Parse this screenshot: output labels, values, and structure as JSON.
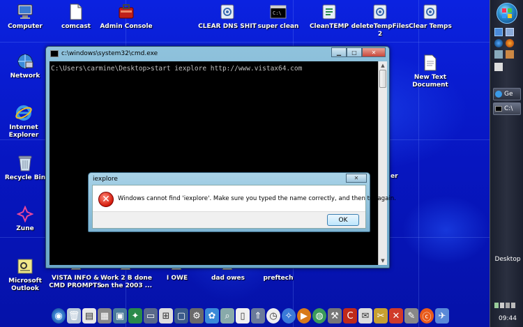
{
  "desktop": {
    "icons": [
      {
        "label": "Computer",
        "icon": "computer-icon"
      },
      {
        "label": "comcast",
        "icon": "document-icon"
      },
      {
        "label": "Admin Console",
        "icon": "toolbox-icon"
      },
      {
        "label": "CLEAR DNS SHIT",
        "icon": "script-icon"
      },
      {
        "label": "super clean",
        "icon": "cmd-icon"
      },
      {
        "label": "CleanTEMP",
        "icon": "script-icon"
      },
      {
        "label": "deleteTempFiles 2",
        "icon": "script-icon"
      },
      {
        "label": "Clear Temps",
        "icon": "script-icon"
      },
      {
        "label": "Network",
        "icon": "network-icon"
      },
      {
        "label": "New Text Document",
        "icon": "text-file-icon"
      },
      {
        "label": "Internet Explorer",
        "icon": "ie-icon"
      },
      {
        "label": "Recycle Bin",
        "icon": "recycle-bin-icon"
      },
      {
        "label": "Zune",
        "icon": "zune-icon"
      },
      {
        "label": "Microsoft Outlook",
        "icon": "outlook-icon"
      },
      {
        "label": "VISTA INFO & CMD PROMPTS",
        "icon": "folder-icon"
      },
      {
        "label": "Work 2 B done on the 2003 ...",
        "icon": "folder-icon"
      },
      {
        "label": "I OWE",
        "icon": "folder-icon"
      },
      {
        "label": "dad owes",
        "icon": "folder-icon"
      },
      {
        "label": "preftech",
        "icon": "folder-icon"
      }
    ],
    "partial_label": "er"
  },
  "cmd_window": {
    "title": "c:\\windows\\system32\\cmd.exe",
    "minimize": "▁",
    "maximize": "□",
    "close": "✕",
    "console_line": "C:\\Users\\carmine\\Desktop>start iexplore http://www.vistax64.com"
  },
  "dialog": {
    "title": "iexplore",
    "close": "✕",
    "message": "Windows cannot find 'iexplore'. Make sure you typed the name correctly, and then try again.",
    "ok_label": "OK"
  },
  "sidebar": {
    "tasks": [
      {
        "label": "Ge",
        "icon": "ie-icon"
      },
      {
        "label": "C:\\",
        "icon": "cmd-icon"
      }
    ],
    "desktop_label": "Desktop",
    "clock": "09:44"
  }
}
